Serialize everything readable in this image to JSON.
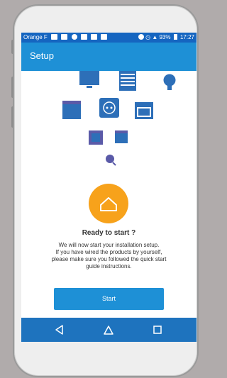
{
  "status_bar": {
    "carrier": "Orange F",
    "battery_percent": "93%",
    "time": "17:27"
  },
  "app_bar": {
    "title": "Setup"
  },
  "device_icons": [
    "tv-icon",
    "shutter-icon",
    "lightbulb-icon",
    "oven-icon",
    "plug-icon",
    "boiler-icon",
    "window-icon",
    "blind-icon",
    "garage-icon",
    "sensor-icon"
  ],
  "main": {
    "heading": "Ready to start ?",
    "description_lines": [
      "We will now start your installation setup.",
      "If you have wired the products by yourself,",
      "please make sure you followed the quick start",
      "guide instructions."
    ],
    "start_label": "Start"
  },
  "nav_bar": {
    "items": [
      "back-icon",
      "home-icon",
      "recents-icon"
    ]
  },
  "colors": {
    "status_bar": "#1565c0",
    "app_bar": "#1e90d6",
    "nav_bar": "#1e73be",
    "accent_orange": "#f7a21b",
    "device_blue": "#2d6fb8",
    "device_purple": "#5a5aa8"
  }
}
